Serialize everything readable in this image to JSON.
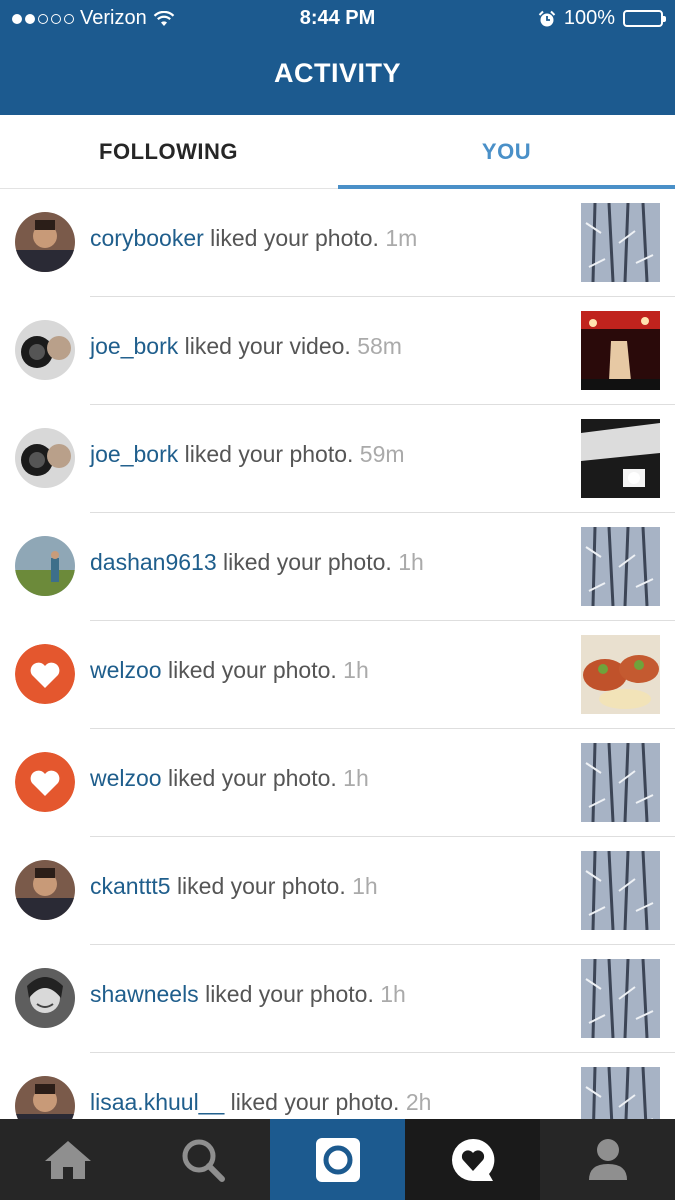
{
  "status_bar": {
    "carrier": "Verizon",
    "time": "8:44 PM",
    "battery": "100%"
  },
  "header": {
    "title": "ACTIVITY"
  },
  "tabs": [
    {
      "label": "FOLLOWING",
      "selected": false
    },
    {
      "label": "YOU",
      "selected": true
    }
  ],
  "notifications": [
    {
      "user": "corybooker",
      "action": "liked your photo.",
      "ago": "1m",
      "avatar": "portrait-photo",
      "thumb": "snowy-trees"
    },
    {
      "user": "joe_bork",
      "action": "liked your video.",
      "ago": "58m",
      "avatar": "camera-selfie",
      "thumb": "stage-performance"
    },
    {
      "user": "joe_bork",
      "action": "liked your photo.",
      "ago": "59m",
      "avatar": "camera-selfie",
      "thumb": "vehicle-sign"
    },
    {
      "user": "dashan9613",
      "action": "liked your photo.",
      "ago": "1h",
      "avatar": "outdoor-person",
      "thumb": "snowy-trees"
    },
    {
      "user": "welzoo",
      "action": "liked your photo.",
      "ago": "1h",
      "avatar": "heart-logo",
      "thumb": "tacos"
    },
    {
      "user": "welzoo",
      "action": "liked your photo.",
      "ago": "1h",
      "avatar": "heart-logo",
      "thumb": "snowy-trees"
    },
    {
      "user": "ckanttt5",
      "action": "liked your photo.",
      "ago": "1h",
      "avatar": "portrait-photo",
      "thumb": "snowy-trees"
    },
    {
      "user": "shawneels",
      "action": "liked your photo.",
      "ago": "1h",
      "avatar": "portrait-bw",
      "thumb": "snowy-trees"
    },
    {
      "user": "lisaa.khuul__",
      "action": "liked your photo.",
      "ago": "2h",
      "avatar": "portrait-photo",
      "thumb": "snowy-trees"
    }
  ],
  "bottom_nav": [
    {
      "icon": "home-icon",
      "active": false
    },
    {
      "icon": "search-icon",
      "active": false
    },
    {
      "icon": "camera-icon",
      "active": true
    },
    {
      "icon": "activity-heart-icon",
      "active": false
    },
    {
      "icon": "profile-icon",
      "active": false
    }
  ],
  "colors": {
    "brand_blue": "#1c5a8f",
    "tab_active": "#4a90c8",
    "username": "#1f5e8c",
    "nav_bg": "#262626",
    "heart_logo": "#e4572e"
  }
}
